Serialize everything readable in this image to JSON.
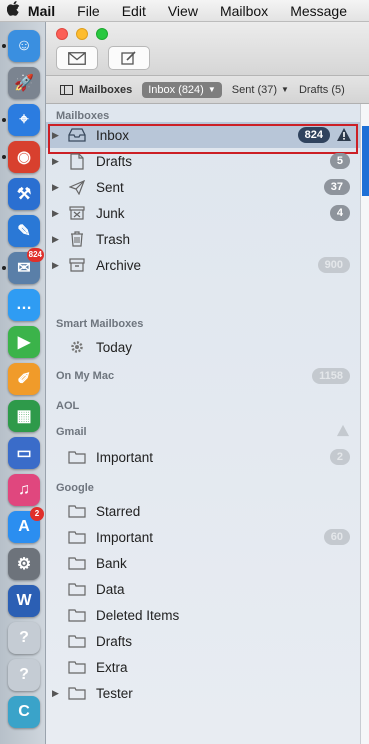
{
  "menubar": {
    "apple": "",
    "items": [
      "Mail",
      "File",
      "Edit",
      "View",
      "Mailbox",
      "Message"
    ]
  },
  "dock": {
    "apps": [
      {
        "name": "Finder",
        "color": "#3a8fe0",
        "glyph": "☺"
      },
      {
        "name": "Launchpad",
        "color": "#7b8490",
        "glyph": "🚀"
      },
      {
        "name": "Safari",
        "color": "#2b7ce0",
        "glyph": "⌖"
      },
      {
        "name": "Chrome",
        "color": "#d8402e",
        "glyph": "◉"
      },
      {
        "name": "Xcode",
        "color": "#2a6fd1",
        "glyph": "⚒"
      },
      {
        "name": "Simulator",
        "color": "#2a78d6",
        "glyph": "✎"
      },
      {
        "name": "Mail Dock",
        "color": "#5a7fa8",
        "glyph": "✉",
        "badge": "824"
      },
      {
        "name": "Messages",
        "color": "#2f9cf3",
        "glyph": "…"
      },
      {
        "name": "FaceTime",
        "color": "#3bb34a",
        "glyph": "▶"
      },
      {
        "name": "Pages",
        "color": "#f09b2a",
        "glyph": "✐"
      },
      {
        "name": "Numbers",
        "color": "#2e9a4a",
        "glyph": "▦"
      },
      {
        "name": "Keynote",
        "color": "#3a6cc9",
        "glyph": "▭"
      },
      {
        "name": "iTunes",
        "color": "#e0477e",
        "glyph": "♫"
      },
      {
        "name": "App Store",
        "color": "#2b8ef0",
        "glyph": "A",
        "badge": "2"
      },
      {
        "name": "System Preferences",
        "color": "#6d737b",
        "glyph": "⚙"
      },
      {
        "name": "Word",
        "color": "#2b5fb4",
        "glyph": "W"
      },
      {
        "name": "Unknown 1",
        "color": "#c5ccd4",
        "glyph": "?"
      },
      {
        "name": "Unknown 2",
        "color": "#c5ccd4",
        "glyph": "?"
      },
      {
        "name": "App C",
        "color": "#3aa3c9",
        "glyph": "C"
      }
    ]
  },
  "toolbar": {
    "compose_icon": "envelope-icon",
    "new_icon": "compose-icon"
  },
  "favorites": {
    "mailboxes": "Mailboxes",
    "inbox": "Inbox (824)",
    "sent": "Sent (37)",
    "drafts": "Drafts (5)"
  },
  "sections": {
    "mailboxes": "Mailboxes",
    "smart": "Smart Mailboxes",
    "onmymac": "On My Mac",
    "aol": "AOL",
    "gmail": "Gmail",
    "google": "Google"
  },
  "mailboxes": [
    {
      "label": "Inbox",
      "badge": "824",
      "icon": "inbox-tray-icon"
    },
    {
      "label": "Drafts",
      "badge": "5",
      "icon": "document-icon"
    },
    {
      "label": "Sent",
      "badge": "37",
      "icon": "paper-plane-icon"
    },
    {
      "label": "Junk",
      "badge": "4",
      "icon": "junk-icon"
    },
    {
      "label": "Trash",
      "badge": "",
      "icon": "trash-icon"
    },
    {
      "label": "Archive",
      "badge": "900",
      "icon": "archive-box-icon"
    }
  ],
  "smart": {
    "today": "Today"
  },
  "onmymac_badge": "1158",
  "gmail": {
    "important": "Important",
    "badge": "2"
  },
  "google": {
    "starred": "Starred",
    "important": "Important",
    "important_badge": "60",
    "bank": "Bank",
    "data": "Data",
    "deleted": "Deleted Items",
    "drafts": "Drafts",
    "extra": "Extra",
    "tester": "Tester"
  },
  "colors": {
    "selection_outline": "#cc1f25",
    "selected_badge": "#30435e"
  }
}
